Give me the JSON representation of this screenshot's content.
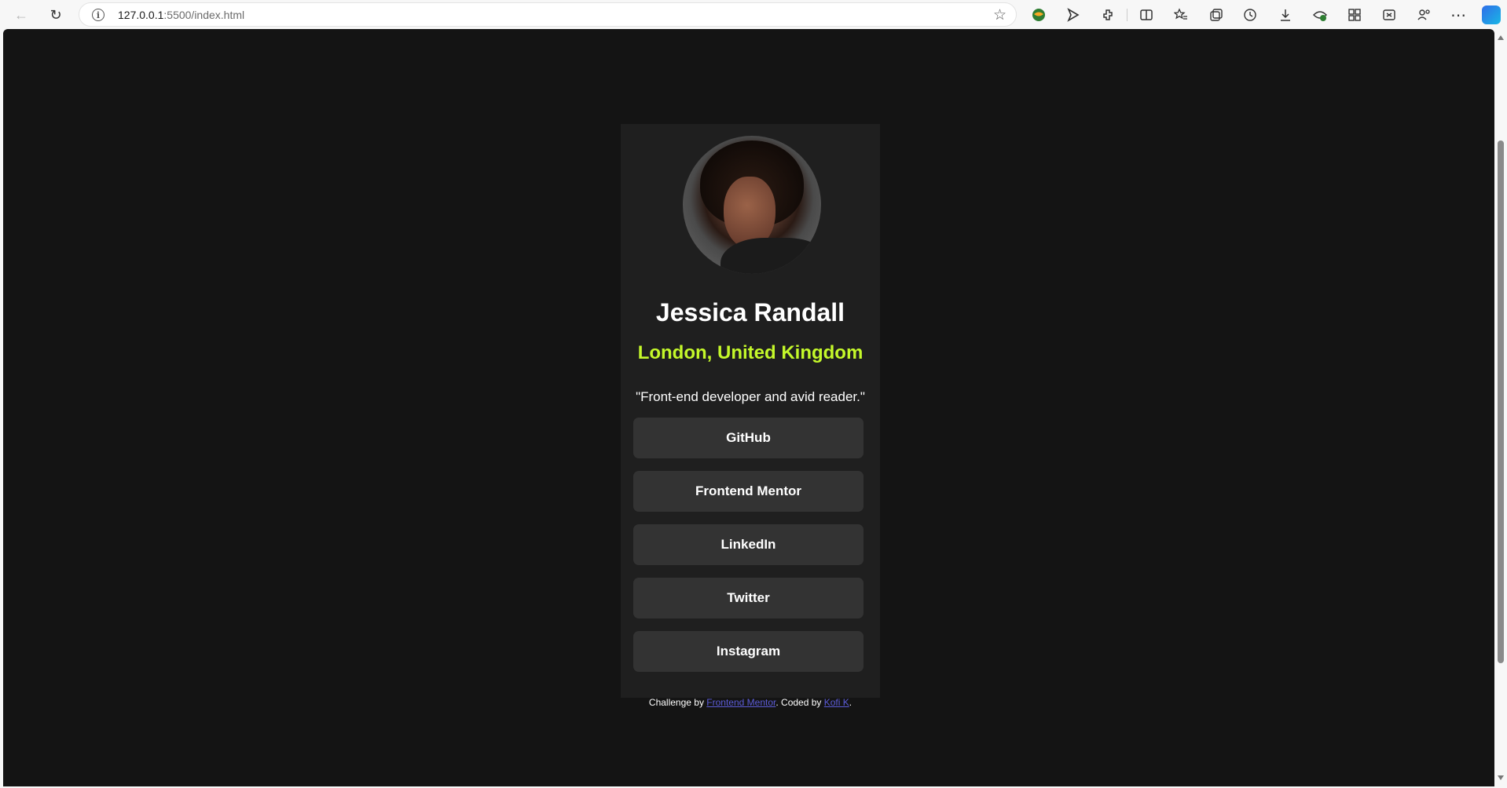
{
  "browser": {
    "url_host": "127.0.0.1",
    "url_path": ":5500/index.html",
    "icons": {
      "back": "back-arrow-icon",
      "reload": "reload-icon",
      "info": "info-icon",
      "star": "star-icon"
    },
    "glyphs": {
      "back": "←",
      "reload": "↻",
      "info": "i",
      "star": "☆",
      "more": "⋯"
    }
  },
  "profile": {
    "name": "Jessica Randall",
    "location": "London, United Kingdom",
    "bio": "\"Front-end developer and avid reader.\"",
    "links": [
      {
        "label": "GitHub"
      },
      {
        "label": "Frontend Mentor"
      },
      {
        "label": "LinkedIn"
      },
      {
        "label": "Twitter"
      },
      {
        "label": "Instagram"
      }
    ]
  },
  "footer": {
    "prefix": "Challenge by ",
    "link1": "Frontend Mentor",
    "middle": ". Coded by ",
    "link2": "Kofi K",
    "suffix": "."
  },
  "colors": {
    "page_bg": "#141414",
    "card_bg": "#1f1f1f",
    "button_bg": "#333333",
    "accent": "#c4f82a",
    "link": "#5b5bd6"
  }
}
